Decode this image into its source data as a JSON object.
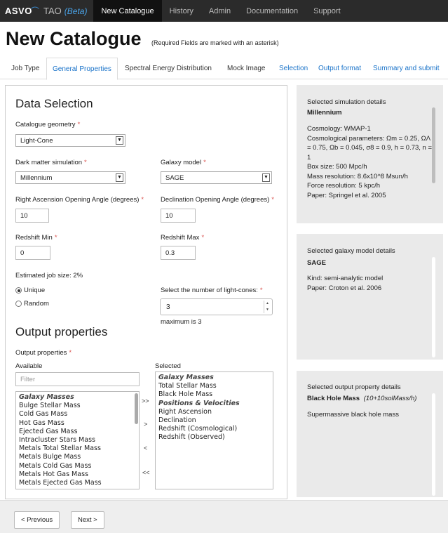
{
  "nav": {
    "logo": "ASVO",
    "brand": "TAO",
    "beta": "(Beta)",
    "items": [
      {
        "label": "New Catalogue",
        "active": true
      },
      {
        "label": "History",
        "active": false
      },
      {
        "label": "Admin",
        "active": false
      },
      {
        "label": "Documentation",
        "active": false
      },
      {
        "label": "Support",
        "active": false
      }
    ]
  },
  "page": {
    "title": "New Catalogue",
    "note": "(Required Fields are marked with an asterisk)"
  },
  "tabs": [
    "Job Type",
    "General Properties",
    "Spectral Energy Distribution",
    "Mock Image",
    "Selection",
    "Output format",
    "Summary and submit"
  ],
  "data_selection": {
    "title": "Data Selection",
    "geometry_label": "Catalogue geometry",
    "geometry_value": "Light-Cone",
    "dm_label": "Dark matter simulation",
    "dm_value": "Millennium",
    "galaxy_label": "Galaxy model",
    "galaxy_value": "SAGE",
    "ra_label": "Right Ascension Opening Angle (degrees)",
    "ra_value": "10",
    "dec_label": "Declination Opening Angle (degrees)",
    "dec_value": "10",
    "zmin_label": "Redshift Min",
    "zmin_value": "0",
    "zmax_label": "Redshift Max",
    "zmax_value": "0.3",
    "job_size": "Estimated job size: 2%",
    "radio_unique": "Unique",
    "radio_random": "Random",
    "cones_label": "Select the number of light-cones:",
    "cones_value": "3",
    "cones_max": "maximum is 3",
    "asterisk": "*"
  },
  "output": {
    "title": "Output properties",
    "props_label": "Output properties",
    "available_label": "Available",
    "selected_label": "Selected",
    "filter_placeholder": "Filter",
    "available": [
      {
        "text": "Galaxy Masses",
        "group": true
      },
      {
        "text": "Bulge Stellar Mass",
        "group": false
      },
      {
        "text": "Cold Gas Mass",
        "group": false
      },
      {
        "text": "Hot Gas Mass",
        "group": false
      },
      {
        "text": "Ejected Gas Mass",
        "group": false
      },
      {
        "text": "Intracluster Stars Mass",
        "group": false
      },
      {
        "text": "Metals Total Stellar Mass",
        "group": false
      },
      {
        "text": "Metals Bulge Mass",
        "group": false
      },
      {
        "text": "Metals Cold Gas Mass",
        "group": false
      },
      {
        "text": "Metals Hot Gas Mass",
        "group": false
      },
      {
        "text": "Metals Ejected Gas Mass",
        "group": false
      }
    ],
    "selected": [
      {
        "text": "Galaxy Masses",
        "group": true
      },
      {
        "text": "Total Stellar Mass",
        "group": false
      },
      {
        "text": "Black Hole Mass",
        "group": false
      },
      {
        "text": "Positions & Velocities",
        "group": true
      },
      {
        "text": "Right Ascension",
        "group": false
      },
      {
        "text": "Declination",
        "group": false
      },
      {
        "text": "Redshift (Cosmological)",
        "group": false
      },
      {
        "text": "Redshift (Observed)",
        "group": false
      }
    ],
    "btn_add_all": ">>",
    "btn_add": ">",
    "btn_remove": "<",
    "btn_remove_all": "<<"
  },
  "sim_card": {
    "label": "Selected simulation details",
    "name": "Millennium",
    "lines": [
      "Cosmology: WMAP-1",
      "Cosmological parameters: Ωm = 0.25, ΩΛ = 0.75, Ωb = 0.045, σ8 = 0.9, h = 0.73, n = 1",
      "Box size: 500 Mpc/h",
      "Mass resolution: 8.6x10^8 Msun/h",
      "Force resolution: 5 kpc/h",
      "Paper: Springel et al. 2005"
    ]
  },
  "galaxy_card": {
    "label": "Selected galaxy model details",
    "name": "SAGE",
    "lines": [
      "Kind: semi-analytic model",
      "Paper: Croton et al. 2006"
    ]
  },
  "prop_card": {
    "label": "Selected output property details",
    "name": "Black Hole Mass",
    "unit": "(10+10solMass/h)",
    "desc": "Supermassive black hole mass"
  },
  "footer": {
    "prev": "< Previous",
    "next": "Next >"
  }
}
